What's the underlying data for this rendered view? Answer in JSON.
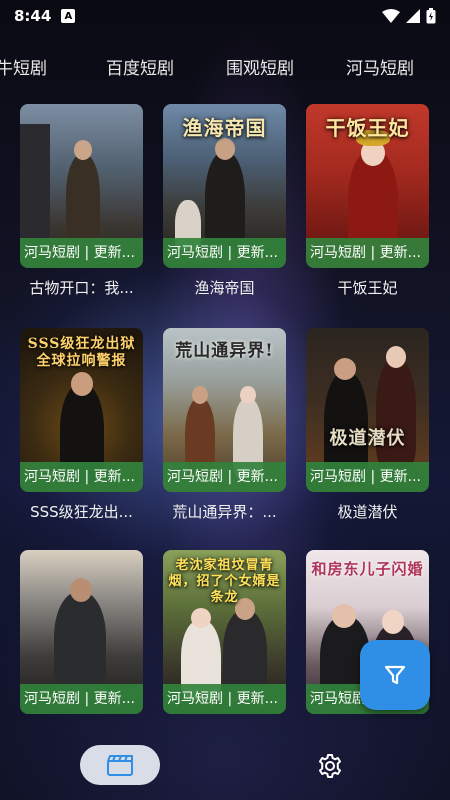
{
  "status_bar": {
    "time": "8:44",
    "notification_letter": "A"
  },
  "tabs": [
    {
      "label": "牛短剧"
    },
    {
      "label": "百度短剧"
    },
    {
      "label": "围观短剧"
    },
    {
      "label": "河马短剧"
    }
  ],
  "cards": [
    {
      "title": "古物开口：我...",
      "tag": "河马短剧 | 更新...",
      "poster_title": ""
    },
    {
      "title": "渔海帝国",
      "tag": "河马短剧 | 更新...",
      "poster_title": "渔海帝国"
    },
    {
      "title": "干饭王妃",
      "tag": "河马短剧 | 更新...",
      "poster_title": "干饭王妃"
    },
    {
      "title": "SSS级狂龙出...",
      "tag": "河马短剧 | 更新...",
      "poster_title": "SSS级狂龙出狱 全球拉响警报"
    },
    {
      "title": "荒山通异界：...",
      "tag": "河马短剧 | 更新...",
      "poster_title": "荒山通异界!"
    },
    {
      "title": "极道潜伏",
      "tag": "河马短剧 | 更新...",
      "poster_title": "极道潜伏"
    },
    {
      "title": "",
      "tag": "河马短剧 | 更新...",
      "poster_title": ""
    },
    {
      "title": "",
      "tag": "河马短剧 | 更新...",
      "poster_title": "老沈家祖坟冒青烟，招了个女婿是条龙"
    },
    {
      "title": "",
      "tag": "河马短剧 | 更新...",
      "poster_title": "和房东儿子闪婚"
    }
  ],
  "icons": {
    "filter": "filter-icon",
    "home": "clapperboard-icon",
    "settings": "gear-icon"
  },
  "colors": {
    "tag_bg": "#32823c",
    "fab": "#2f8fe6",
    "nav_active": "#d9dde8",
    "nav_icon": "#2f8fe6"
  }
}
